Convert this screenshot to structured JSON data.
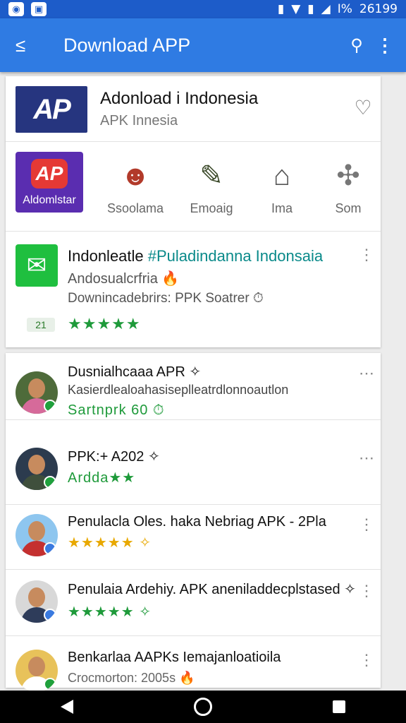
{
  "appbar": {
    "title": "Download APP"
  },
  "statusbar": {
    "time": "26199",
    "signal_text": "I%"
  },
  "featured": {
    "logo_text": "AP",
    "title": "Adonload i Indonesia",
    "subtitle": "APK Innesia"
  },
  "categories": [
    {
      "label": "Aldomlstar",
      "icon": "ap-logo-icon"
    },
    {
      "label": "Ssoolama",
      "icon": "ninja-icon"
    },
    {
      "label": "Emoaig",
      "icon": "brush-icon"
    },
    {
      "label": "Ima",
      "icon": "house-icon"
    },
    {
      "label": "Som",
      "icon": "puzzle-icon"
    }
  ],
  "app": {
    "name_plain": "Indonleatle ",
    "name_highlight": "#Puladindanna Indonsaia",
    "developer": "Andosualcrfria 🔥",
    "description": "Downincadebrirs: PPK Soatrer ⏱",
    "badge": "21",
    "stars": "★★★★★"
  },
  "reviews": [
    {
      "title": "Dusnialhcaaa APR ✧",
      "line": "Kasierdlealoahasiseplleatrdlonnoautlon",
      "meta": "Sartnprk 60 ⏱",
      "stars": "",
      "accent": "#1fa03c"
    },
    {
      "title": "PPK:+ A202 ✧",
      "line": "",
      "meta": "",
      "stars": "Ardda★★",
      "accent": "#1fa03c"
    },
    {
      "title": "Penulacla Oles. haka Nebriag APK - 2Pla",
      "line": "",
      "meta": "",
      "stars": "★★★★★ ✧",
      "accent": "#e8a800"
    },
    {
      "title": "Penulaia Ardehiy. APK aneniladdecplstased ✧",
      "line": "",
      "meta": "",
      "stars": "★★★★★ ✧",
      "accent": "#1fa03c"
    },
    {
      "title": "Benkarlaa AAPKs Iemajanloatioila",
      "line": "Crocmorton: 2005s 🔥",
      "meta": "",
      "stars": "",
      "accent": "#1fa03c"
    }
  ]
}
